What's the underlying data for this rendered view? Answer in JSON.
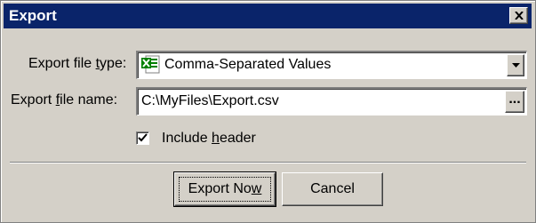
{
  "window": {
    "title": "Export"
  },
  "file_type": {
    "label_pre": "Export file ",
    "label_accel": "t",
    "label_post": "ype:",
    "value": "Comma-Separated Values",
    "icon": "excel-file-icon"
  },
  "file_name": {
    "label_pre": "Export ",
    "label_accel": "f",
    "label_post": "ile name:",
    "value": "C:\\MyFiles\\Export.csv",
    "browse_label": "..."
  },
  "include_header": {
    "label_pre": "Include ",
    "label_accel": "h",
    "label_post": "eader",
    "checked": true
  },
  "buttons": {
    "export_pre": "Export No",
    "export_accel": "w",
    "cancel": "Cancel"
  },
  "colors": {
    "titlebar": "#0a246a",
    "face": "#d4d0c8"
  }
}
